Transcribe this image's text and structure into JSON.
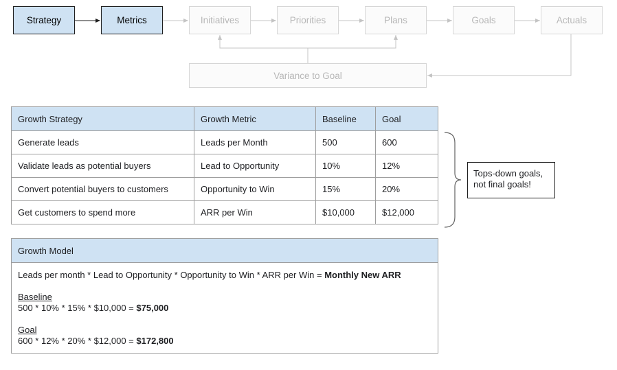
{
  "flow": {
    "nodes": [
      {
        "id": "strategy",
        "label": "Strategy",
        "active": true
      },
      {
        "id": "metrics",
        "label": "Metrics",
        "active": true
      },
      {
        "id": "initiatives",
        "label": "Initiatives",
        "active": false
      },
      {
        "id": "priorities",
        "label": "Priorities",
        "active": false
      },
      {
        "id": "plans",
        "label": "Plans",
        "active": false
      },
      {
        "id": "goals",
        "label": "Goals",
        "active": false
      },
      {
        "id": "actuals",
        "label": "Actuals",
        "active": false
      },
      {
        "id": "variance",
        "label": "Variance to Goal",
        "active": false
      }
    ],
    "colors": {
      "active_fill": "#cfe2f3",
      "active_border": "#1f1f1f",
      "faded_border": "#d6d6d6",
      "faded_text": "#b7b7b7"
    }
  },
  "strategy_table": {
    "headers": [
      "Growth Strategy",
      "Growth Metric",
      "Baseline",
      "Goal"
    ],
    "rows": [
      [
        "Generate leads",
        "Leads per Month",
        "500",
        "600"
      ],
      [
        "Validate leads as potential buyers",
        "Lead to Opportunity",
        "10%",
        "12%"
      ],
      [
        "Convert potential buyers to customers",
        "Opportunity to Win",
        "15%",
        "20%"
      ],
      [
        "Get customers to spend more",
        "ARR per Win",
        "$10,000",
        "$12,000"
      ]
    ]
  },
  "growth_model": {
    "title": "Growth Model",
    "formula_text": "Leads per month * Lead to Opportunity * Opportunity to Win * ARR per Win = ",
    "formula_result": "Monthly New ARR",
    "baseline_label": "Baseline",
    "baseline_calc": "500 * 10% * 15% * $10,000 = ",
    "baseline_result": "$75,000",
    "goal_label": "Goal",
    "goal_calc": "600 * 12% * 20% * $12,000 = ",
    "goal_result": "$172,800"
  },
  "callout": {
    "line1": "Tops-down goals,",
    "line2": "not final goals!"
  }
}
